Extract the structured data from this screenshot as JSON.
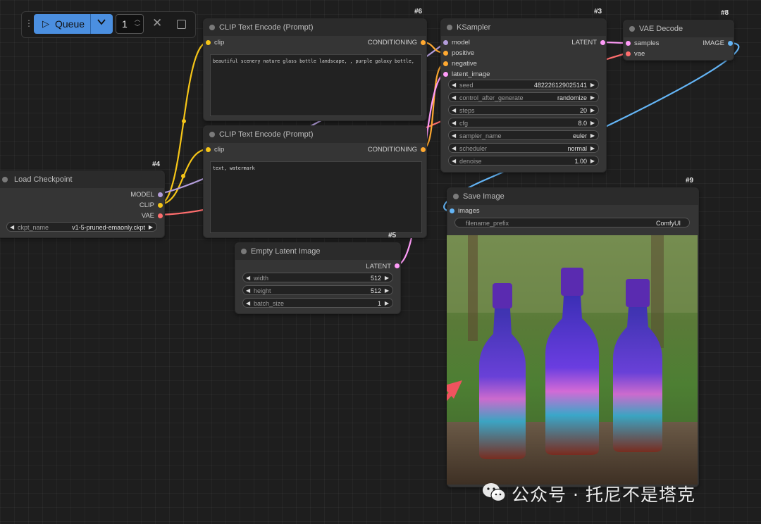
{
  "toolbar": {
    "queue_label": "Queue",
    "batch_count": "1"
  },
  "nodes": {
    "load_checkpoint": {
      "id": "#4",
      "title": "Load Checkpoint",
      "outputs": [
        "MODEL",
        "CLIP",
        "VAE"
      ],
      "ckpt_label": "ckpt_name",
      "ckpt_value": "v1-5-pruned-emaonly.ckpt"
    },
    "clip_pos": {
      "id": "#6",
      "title": "CLIP Text Encode (Prompt)",
      "input": "clip",
      "output": "CONDITIONING",
      "text": "beautiful scenery nature glass bottle landscape, , purple galaxy bottle,"
    },
    "clip_neg": {
      "title": "CLIP Text Encode (Prompt)",
      "input": "clip",
      "output": "CONDITIONING",
      "text": "text, watermark"
    },
    "ksampler": {
      "id": "#3",
      "title": "KSampler",
      "inputs": [
        "model",
        "positive",
        "negative",
        "latent_image"
      ],
      "output": "LATENT",
      "widgets": [
        {
          "label": "seed",
          "value": "482226129025141"
        },
        {
          "label": "control_after_generate",
          "value": "randomize"
        },
        {
          "label": "steps",
          "value": "20"
        },
        {
          "label": "cfg",
          "value": "8.0"
        },
        {
          "label": "sampler_name",
          "value": "euler"
        },
        {
          "label": "scheduler",
          "value": "normal"
        },
        {
          "label": "denoise",
          "value": "1.00"
        }
      ]
    },
    "vae_decode": {
      "id": "#8",
      "title": "VAE Decode",
      "inputs": [
        "samples",
        "vae"
      ],
      "output": "IMAGE"
    },
    "empty_latent": {
      "id": "#5",
      "title": "Empty Latent Image",
      "output": "LATENT",
      "widgets": [
        {
          "label": "width",
          "value": "512"
        },
        {
          "label": "height",
          "value": "512"
        },
        {
          "label": "batch_size",
          "value": "1"
        }
      ]
    },
    "save_image": {
      "id": "#9",
      "title": "Save Image",
      "input": "images",
      "prefix_label": "filename_prefix",
      "prefix_value": "ComfyUI"
    }
  },
  "watermark": {
    "text": "公众号 · 托尼不是塔克"
  },
  "colors": {
    "clip": "#f5c518",
    "model": "#b39ddb",
    "vae": "#ff6e6e",
    "conditioning": "#ffa931",
    "latent": "#ff9cf9",
    "image": "#64b5f6",
    "queue": "#4b8fe0",
    "annotation_arrow": "#f0535e"
  }
}
